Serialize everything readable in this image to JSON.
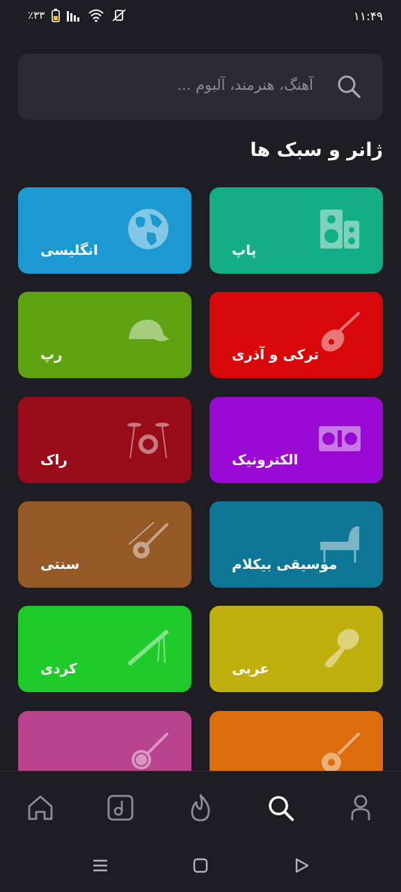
{
  "status_bar": {
    "time": "۱۱:۴۹",
    "battery": "٪۳۳"
  },
  "search": {
    "placeholder": "آهنگ، هنرمند، آلبوم ..."
  },
  "section_title": "ژانر و سبک ها",
  "genres": [
    {
      "label": "پاپ",
      "color": "#14ae86",
      "icon": "speaker-icon"
    },
    {
      "label": "انگلیسی",
      "color": "#1d99d2",
      "icon": "globe-icon"
    },
    {
      "label": "ترکی و آذری",
      "color": "#d8070a",
      "icon": "saz-icon"
    },
    {
      "label": "رپ",
      "color": "#5fa313",
      "icon": "cap-icon"
    },
    {
      "label": "الکترونیک",
      "color": "#9a0ad3",
      "icon": "dj-mixer-icon"
    },
    {
      "label": "راک",
      "color": "#9a0b1a",
      "icon": "drum-kit-icon"
    },
    {
      "label": "موسیقی بیکلام",
      "color": "#0e7796",
      "icon": "piano-icon"
    },
    {
      "label": "سنتی",
      "color": "#955927",
      "icon": "setar-icon"
    },
    {
      "label": "عربی",
      "color": "#c0b00e",
      "icon": "darbuka-icon"
    },
    {
      "label": "کردی",
      "color": "#1ecb2a",
      "icon": "flute-icon"
    },
    {
      "label": "",
      "color": "#db6d0d",
      "icon": "guitar-icon"
    },
    {
      "label": "",
      "color": "#b9448e",
      "icon": "banjo-icon"
    }
  ],
  "bottom_nav": [
    {
      "name": "profile",
      "icon": "profile-icon"
    },
    {
      "name": "search",
      "icon": "search-icon",
      "active": true
    },
    {
      "name": "trending",
      "icon": "flame-icon"
    },
    {
      "name": "library",
      "icon": "music-note-icon"
    },
    {
      "name": "home",
      "icon": "home-icon"
    }
  ]
}
